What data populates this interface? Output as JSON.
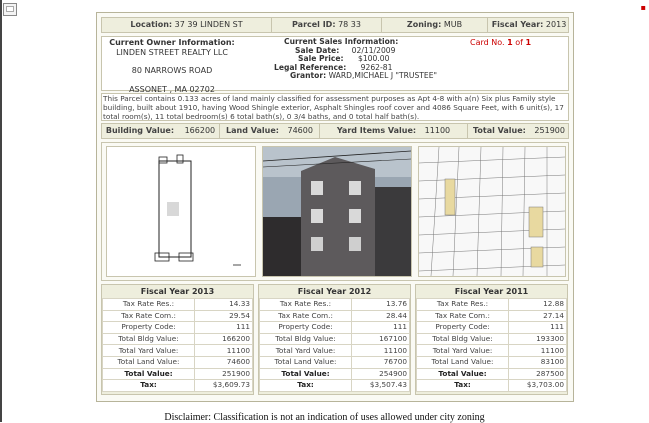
{
  "header": {
    "location_label": "Location:",
    "location_value": "37 39 LINDEN ST",
    "parcel_label": "Parcel ID:",
    "parcel_value": "78 33",
    "zoning_label": "Zoning:",
    "zoning_value": "MUB",
    "fy_label": "Fiscal Year:",
    "fy_value": "2013"
  },
  "owner": {
    "heading": "Current Owner Information:",
    "name": "LINDEN STREET REALTY LLC",
    "address1": "80 NARROWS ROAD",
    "address2": "ASSONET , MA 02702"
  },
  "sales": {
    "heading": "Current Sales Information:",
    "sale_date_label": "Sale Date:",
    "sale_date": "02/11/2009",
    "sale_price_label": "Sale Price:",
    "sale_price": "$100.00",
    "legal_label": "Legal Reference:",
    "legal": "9262-81",
    "grantor_label": "Grantor:",
    "grantor": "WARD,MICHAEL J \"TRUSTEE\""
  },
  "card": {
    "prefix": "Card No.",
    "num": "1",
    "of": "of",
    "total": "1"
  },
  "description": "This Parcel contains 0.133 acres of land mainly classified for assessment purposes as Apt 4-8 with a(n) Six plus Family style building, built about 1910, having Wood Shingle exterior, Asphalt Shingles roof cover and 4086 Square Feet, with 6 unit(s), 17 total room(s), 11 total bedroom(s) 6 total bath(s), 0 3/4 baths, and 0 total half bath(s).",
  "values": {
    "building_label": "Building Value:",
    "building": "166200",
    "land_label": "Land Value:",
    "land": "74600",
    "yard_label": "Yard Items Value:",
    "yard": "11100",
    "total_label": "Total Value:",
    "total": "251900"
  },
  "years": [
    {
      "title": "Fiscal Year 2013",
      "rows": [
        {
          "label": "Tax Rate Res.:",
          "value": "14.33"
        },
        {
          "label": "Tax Rate Com.:",
          "value": "29.54"
        },
        {
          "label": "Property Code:",
          "value": "111"
        },
        {
          "label": "Total Bldg Value:",
          "value": "166200"
        },
        {
          "label": "Total Yard Value:",
          "value": "11100"
        },
        {
          "label": "Total Land Value:",
          "value": "74600"
        },
        {
          "label": "Total Value:",
          "value": "251900"
        },
        {
          "label": "Tax:",
          "value": "$3,609.73"
        }
      ]
    },
    {
      "title": "Fiscal Year 2012",
      "rows": [
        {
          "label": "Tax Rate Res.:",
          "value": "13.76"
        },
        {
          "label": "Tax Rate Com.:",
          "value": "28.44"
        },
        {
          "label": "Property Code:",
          "value": "111"
        },
        {
          "label": "Total Bldg Value:",
          "value": "167100"
        },
        {
          "label": "Total Yard Value:",
          "value": "11100"
        },
        {
          "label": "Total Land Value:",
          "value": "76700"
        },
        {
          "label": "Total Value:",
          "value": "254900"
        },
        {
          "label": "Tax:",
          "value": "$3,507.43"
        }
      ]
    },
    {
      "title": "Fiscal Year 2011",
      "rows": [
        {
          "label": "Tax Rate Res.:",
          "value": "12.88"
        },
        {
          "label": "Tax Rate Com.:",
          "value": "27.14"
        },
        {
          "label": "Property Code:",
          "value": "111"
        },
        {
          "label": "Total Bldg Value:",
          "value": "193300"
        },
        {
          "label": "Total Yard Value:",
          "value": "11100"
        },
        {
          "label": "Total Land Value:",
          "value": "83100"
        },
        {
          "label": "Total Value:",
          "value": "287500"
        },
        {
          "label": "Tax:",
          "value": "$3,703.00"
        }
      ]
    }
  ],
  "disclaimer": "Disclaimer: Classification is not an indication of uses allowed under city zoning",
  "colors": {
    "accent_red": "#cc0000",
    "panel_bg": "#eeeedd",
    "border": "#c8c5ae"
  }
}
